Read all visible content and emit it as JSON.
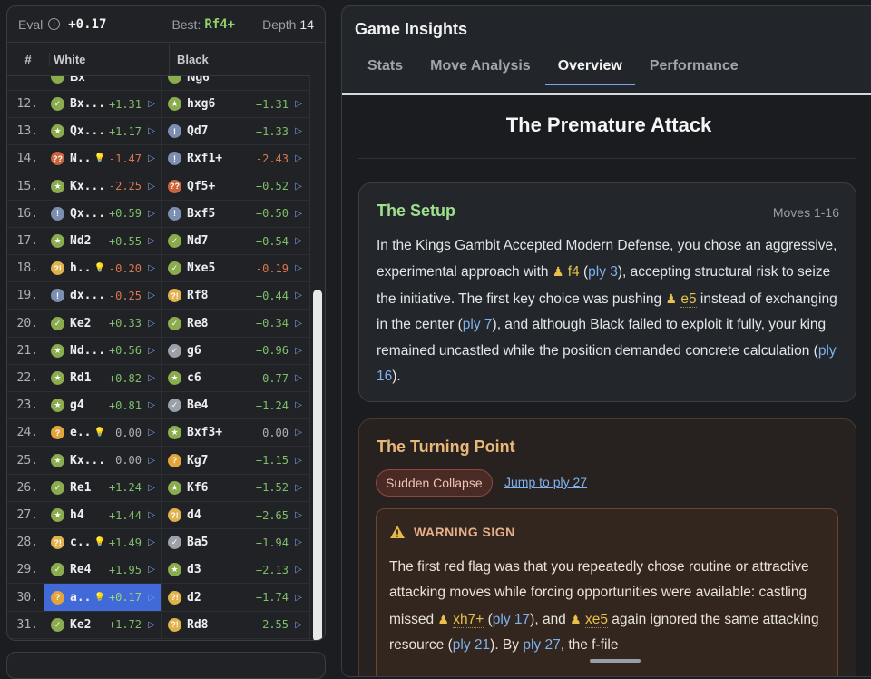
{
  "eval_bar": {
    "label": "Eval",
    "info_glyph": "i",
    "value": "+0.17",
    "best_label": "Best:",
    "best_move": "Rf4+",
    "depth_label": "Depth",
    "depth_value": "14"
  },
  "move_table": {
    "headers": {
      "num": "#",
      "white": "White",
      "black": "Black"
    },
    "partial_top_row": {
      "white_move": "Bx",
      "black_move": "Ng6"
    },
    "rows": [
      {
        "num": "12.",
        "w": {
          "badge": "best",
          "glyph": "✓",
          "move": "Bx...",
          "bulb": false,
          "eval": "+1.31",
          "sign": "pos"
        },
        "b": {
          "badge": "excellent",
          "glyph": "★",
          "move": "hxg6",
          "eval": "+1.31",
          "sign": "pos"
        }
      },
      {
        "num": "13.",
        "w": {
          "badge": "excellent",
          "glyph": "★",
          "move": "Qx...",
          "bulb": false,
          "eval": "+1.17",
          "sign": "pos"
        },
        "b": {
          "badge": "info",
          "glyph": "!",
          "move": "Qd7",
          "eval": "+1.33",
          "sign": "pos"
        }
      },
      {
        "num": "14.",
        "w": {
          "badge": "blunder",
          "glyph": "??",
          "move": "N..",
          "bulb": true,
          "eval": "-1.47",
          "sign": "neg"
        },
        "b": {
          "badge": "info",
          "glyph": "!",
          "move": "Rxf1+",
          "eval": "-2.43",
          "sign": "neg"
        }
      },
      {
        "num": "15.",
        "w": {
          "badge": "excellent",
          "glyph": "★",
          "move": "Kx...",
          "bulb": false,
          "eval": "-2.25",
          "sign": "neg"
        },
        "b": {
          "badge": "blunder",
          "glyph": "??",
          "move": "Qf5+",
          "eval": "+0.52",
          "sign": "pos"
        }
      },
      {
        "num": "16.",
        "w": {
          "badge": "info",
          "glyph": "!",
          "move": "Qx...",
          "bulb": false,
          "eval": "+0.59",
          "sign": "pos"
        },
        "b": {
          "badge": "info",
          "glyph": "!",
          "move": "Bxf5",
          "eval": "+0.50",
          "sign": "pos"
        }
      },
      {
        "num": "17.",
        "w": {
          "badge": "excellent",
          "glyph": "★",
          "move": "Nd2",
          "bulb": false,
          "eval": "+0.55",
          "sign": "pos"
        },
        "b": {
          "badge": "best",
          "glyph": "✓",
          "move": "Nd7",
          "eval": "+0.54",
          "sign": "pos"
        }
      },
      {
        "num": "18.",
        "w": {
          "badge": "dubious",
          "glyph": "?!",
          "move": "h..",
          "bulb": true,
          "eval": "-0.20",
          "sign": "neg"
        },
        "b": {
          "badge": "best",
          "glyph": "✓",
          "move": "Nxe5",
          "eval": "-0.19",
          "sign": "neg"
        }
      },
      {
        "num": "19.",
        "w": {
          "badge": "info",
          "glyph": "!",
          "move": "dx...",
          "bulb": false,
          "eval": "-0.25",
          "sign": "neg"
        },
        "b": {
          "badge": "dubious",
          "glyph": "?!",
          "move": "Rf8",
          "eval": "+0.44",
          "sign": "pos"
        }
      },
      {
        "num": "20.",
        "w": {
          "badge": "best",
          "glyph": "✓",
          "move": "Ke2",
          "bulb": false,
          "eval": "+0.33",
          "sign": "pos"
        },
        "b": {
          "badge": "best",
          "glyph": "✓",
          "move": "Re8",
          "eval": "+0.34",
          "sign": "pos"
        }
      },
      {
        "num": "21.",
        "w": {
          "badge": "excellent",
          "glyph": "★",
          "move": "Nd...",
          "bulb": false,
          "eval": "+0.56",
          "sign": "pos"
        },
        "b": {
          "badge": "book",
          "glyph": "✓",
          "move": "g6",
          "eval": "+0.96",
          "sign": "pos"
        }
      },
      {
        "num": "22.",
        "w": {
          "badge": "excellent",
          "glyph": "★",
          "move": "Rd1",
          "bulb": false,
          "eval": "+0.82",
          "sign": "pos"
        },
        "b": {
          "badge": "excellent",
          "glyph": "★",
          "move": "c6",
          "eval": "+0.77",
          "sign": "pos"
        }
      },
      {
        "num": "23.",
        "w": {
          "badge": "excellent",
          "glyph": "★",
          "move": "g4",
          "bulb": false,
          "eval": "+0.81",
          "sign": "pos"
        },
        "b": {
          "badge": "book",
          "glyph": "✓",
          "move": "Be4",
          "eval": "+1.24",
          "sign": "pos"
        }
      },
      {
        "num": "24.",
        "w": {
          "badge": "mistake",
          "glyph": "?",
          "move": "e..",
          "bulb": true,
          "eval": "0.00",
          "sign": "zero"
        },
        "b": {
          "badge": "excellent",
          "glyph": "★",
          "move": "Bxf3+",
          "eval": "0.00",
          "sign": "zero"
        }
      },
      {
        "num": "25.",
        "w": {
          "badge": "excellent",
          "glyph": "★",
          "move": "Kx...",
          "bulb": false,
          "eval": "0.00",
          "sign": "zero"
        },
        "b": {
          "badge": "mistake",
          "glyph": "?",
          "move": "Kg7",
          "eval": "+1.15",
          "sign": "pos"
        }
      },
      {
        "num": "26.",
        "w": {
          "badge": "best",
          "glyph": "✓",
          "move": "Re1",
          "bulb": false,
          "eval": "+1.24",
          "sign": "pos"
        },
        "b": {
          "badge": "excellent",
          "glyph": "★",
          "move": "Kf6",
          "eval": "+1.52",
          "sign": "pos"
        }
      },
      {
        "num": "27.",
        "w": {
          "badge": "excellent",
          "glyph": "★",
          "move": "h4",
          "bulb": false,
          "eval": "+1.44",
          "sign": "pos"
        },
        "b": {
          "badge": "dubious",
          "glyph": "?!",
          "move": "d4",
          "eval": "+2.65",
          "sign": "pos"
        }
      },
      {
        "num": "28.",
        "w": {
          "badge": "dubious",
          "glyph": "?!",
          "move": "c..",
          "bulb": true,
          "eval": "+1.49",
          "sign": "pos"
        },
        "b": {
          "badge": "book",
          "glyph": "✓",
          "move": "Ba5",
          "eval": "+1.94",
          "sign": "pos"
        }
      },
      {
        "num": "29.",
        "w": {
          "badge": "best",
          "glyph": "✓",
          "move": "Re4",
          "bulb": false,
          "eval": "+1.95",
          "sign": "pos"
        },
        "b": {
          "badge": "excellent",
          "glyph": "★",
          "move": "d3",
          "eval": "+2.13",
          "sign": "pos"
        }
      },
      {
        "num": "30.",
        "w": {
          "badge": "mistake",
          "glyph": "?",
          "move": "a..",
          "bulb": true,
          "eval": "+0.17",
          "sign": "pos",
          "selected": true
        },
        "b": {
          "badge": "dubious",
          "glyph": "?!",
          "move": "d2",
          "eval": "+1.74",
          "sign": "pos"
        }
      },
      {
        "num": "31.",
        "w": {
          "badge": "best",
          "glyph": "✓",
          "move": "Ke2",
          "bulb": false,
          "eval": "+1.72",
          "sign": "pos"
        },
        "b": {
          "badge": "dubious",
          "glyph": "?!",
          "move": "Rd8",
          "eval": "+2.55",
          "sign": "pos"
        }
      }
    ]
  },
  "insights": {
    "title": "Game Insights",
    "tabs": [
      "Stats",
      "Move Analysis",
      "Overview",
      "Performance"
    ],
    "active_tab": "Overview",
    "article_title": "The Premature Attack",
    "setup": {
      "title": "The Setup",
      "range": "Moves 1-16",
      "text_html": "In the Kings Gambit Accepted Modern Defense, you chose an aggressive, experimental approach with <span class=\"pawn\">♟</span> <span class=\"mvref\">f4</span> (<span class=\"ply\">ply 3</span>), accepting structural risk to seize the initiative. The first key choice was pushing <span class=\"pawn\">♟</span> <span class=\"mvref\">e5</span> instead of exchanging in the center (<span class=\"ply\">ply 7</span>), and although Black failed to exploit it fully, your king remained uncastled while the position demanded concrete calculation (<span class=\"ply\">ply 16</span>)."
    },
    "turning": {
      "title": "The Turning Point",
      "badge": "Sudden Collapse",
      "link": "Jump to ply 27",
      "warning_label": "WARNING SIGN",
      "warning_html": "The first red flag was that you repeatedly chose routine or attractive attacking moves while forcing opportunities were available: castling missed <span class=\"pawn\">♟</span> <span class=\"mvref\">xh7+</span> (<span class=\"ply\">ply 17</span>), and <span class=\"pawn\">♟</span> <span class=\"mvref\">xe5</span> again ignored the same attacking resource (<span class=\"ply\">ply 21</span>). By <span class=\"ply\">ply 27</span>, the f-file"
    }
  },
  "colors": {
    "accent_blue": "#4169d8",
    "positive": "#7fbf6a",
    "negative": "#d9774f",
    "setup_green": "#9fdf8e",
    "turning_orange": "#e8b87a"
  }
}
